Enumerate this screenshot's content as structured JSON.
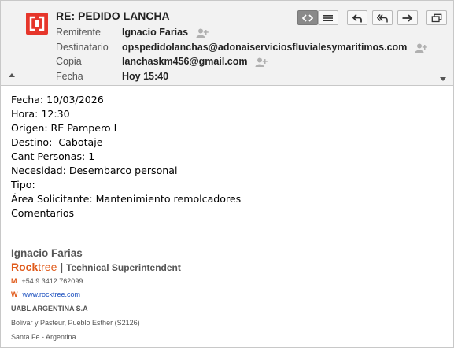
{
  "header": {
    "subject": "RE: PEDIDO LANCHA",
    "fields": [
      {
        "label": "Remitente",
        "value": "Ignacio Farias"
      },
      {
        "label": "Destinatario",
        "value": "opspedidolanchas@adonaiserviciosfluvialesymaritimos.com"
      },
      {
        "label": "Copia",
        "value": "lanchaskm456@gmail.com"
      },
      {
        "label": "Fecha",
        "value": "Hoy 15:40"
      }
    ],
    "toolbar": [
      {
        "name": "source-view-icon"
      },
      {
        "name": "menu-icon"
      },
      {
        "name": "reply-icon"
      },
      {
        "name": "reply-all-icon"
      },
      {
        "name": "forward-icon"
      },
      {
        "name": "open-window-icon"
      }
    ],
    "brand_color": "#e6362b"
  },
  "body": {
    "lines": [
      "Fecha: 10/03/2026",
      "Hora: 12:30",
      "Origen: RE Pampero I",
      "Destino:  Cabotaje",
      "Cant Personas: 1",
      "Necesidad: Desembarco personal",
      "Tipo:",
      "Área Solicitante: Mantenimiento remolcadores",
      "Comentarios"
    ]
  },
  "signature": {
    "name": "Ignacio Farias",
    "company_part1": "Rock",
    "company_part2": "tree",
    "separator": "|",
    "title": "Technical Superintendent",
    "mobile_letter": "M",
    "mobile": "+54 9 3412 762099",
    "web_letter": "W",
    "web": "www.rocktree.com",
    "org": "UABL ARGENTINA S.A",
    "address": "Bolivar y Pasteur, Pueblo Esther (S2126)",
    "region": "Santa Fe - Argentina",
    "accent_color": "#e05a1a",
    "link_color": "#1a4fbf"
  }
}
